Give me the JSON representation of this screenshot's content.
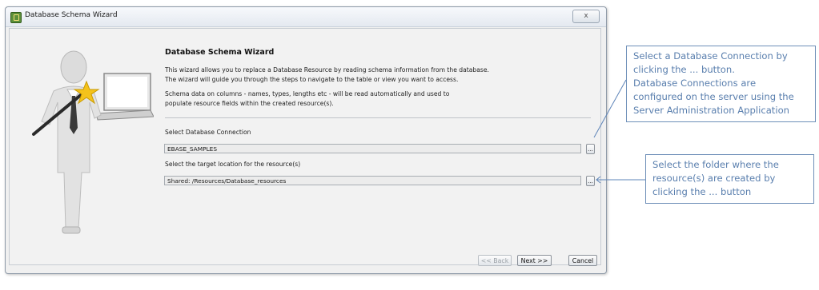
{
  "window": {
    "title": "Database Schema Wizard",
    "close_label": "x"
  },
  "wizard": {
    "heading": "Database Schema Wizard",
    "intro_line1": "This wizard allows you to replace a Database Resource by reading schema information from the database.",
    "intro_line2": "The wizard will guide you through the steps to navigate to the table or view you want to access.",
    "schema_line1": "Schema data on columns - names, types, lengths etc - will be read automatically and used to",
    "schema_line2": "populate resource fields within the created resource(s).",
    "connection_label": "Select Database Connection",
    "connection_value": "EBASE_SAMPLES",
    "location_label": "Select the target location for the resource(s)",
    "location_value": "Shared: /Resources/Database_resources",
    "browse_label": "...",
    "back_label": "<< Back",
    "next_label": "Next >>",
    "cancel_label": "Cancel"
  },
  "callouts": {
    "connection_line1": "Select a Database Connection  by",
    "connection_line2": "clicking  the ... button.",
    "connection_line3": "Database Connections  are",
    "connection_line4": "configured  on the server using  the",
    "connection_line5": "Server Administration Application",
    "folder_line1": "Select the folder where the",
    "folder_line2": "resource(s)  are created by",
    "folder_line3": "clicking  the ... button"
  },
  "icons": [
    "app-icon",
    "close-icon",
    "wizard-illustration"
  ]
}
